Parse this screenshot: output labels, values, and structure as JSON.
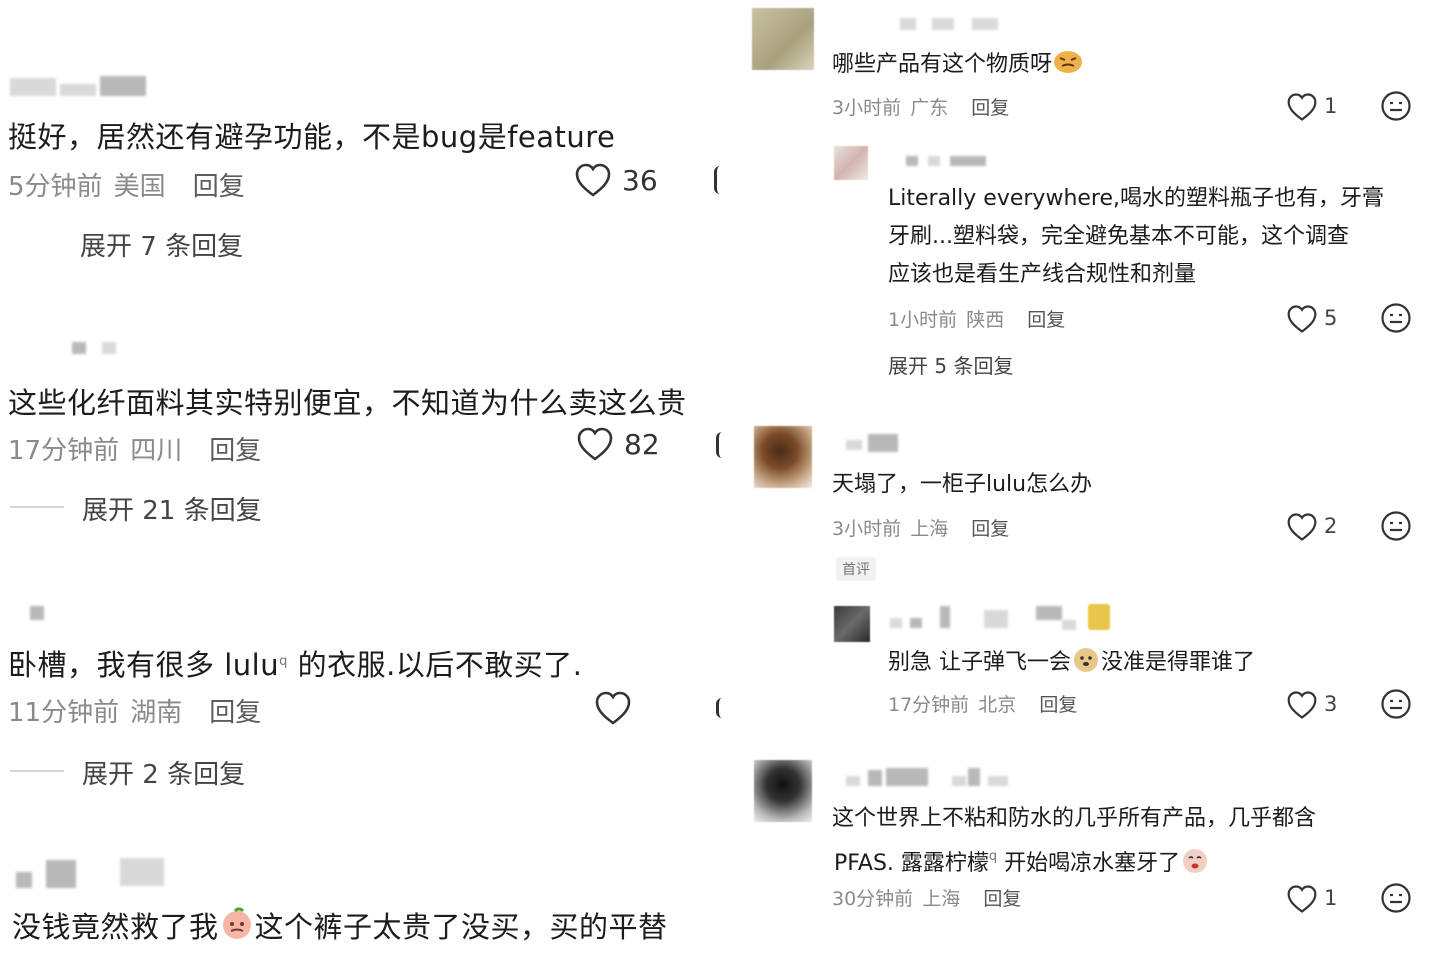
{
  "left": {
    "comments": [
      {
        "text": "挺好，居然还有避孕功能，不是bug是feature",
        "time": "5分钟前",
        "region": "美国",
        "reply": "回复",
        "likes": "36",
        "expand": "展开 7 条回复"
      },
      {
        "text": "这些化纤面料其实特别便宜，不知道为什么卖这么贵",
        "time": "17分钟前",
        "region": "四川",
        "reply": "回复",
        "likes": "82",
        "expand": "展开 21 条回复"
      },
      {
        "text_a": "卧槽，我有很多 lulu",
        "text_b": " 的衣服.以后不敢买了.",
        "time": "11分钟前",
        "region": "湖南",
        "reply": "回复",
        "likes": "",
        "expand": "展开 2 条回复"
      },
      {
        "text_a": "没钱竟然救了我",
        "text_b": "这个裤子太贵了没买，买的平替"
      }
    ]
  },
  "right": {
    "comments": [
      {
        "text": "哪些产品有这个物质呀",
        "time": "3小时前",
        "region": "广东",
        "reply": "回复",
        "likes": "1"
      },
      {
        "lines": [
          "Literally everywhere,喝水的塑料瓶子也有，牙膏",
          "牙刷...塑料袋，完全避免基本不可能，这个调查",
          "应该也是看生产线合规性和剂量"
        ],
        "time": "1小时前",
        "region": "陕西",
        "reply": "回复",
        "likes": "5",
        "expand": "展开 5 条回复"
      },
      {
        "text": "天塌了，一柜子lulu怎么办",
        "time": "3小时前",
        "region": "上海",
        "reply": "回复",
        "likes": "2",
        "badge": "首评"
      },
      {
        "text_a": "别急 让子弹飞一会",
        "text_b": "没准是得罪谁了",
        "time": "17分钟前",
        "region": "北京",
        "reply": "回复",
        "likes": "3"
      },
      {
        "line1": "这个世界上不粘和防水的几乎所有产品，几乎都含",
        "line2_a": "PFAS. 露露柠檬",
        "line2_b": " 开始喝凉水塞牙了",
        "time": "30分钟前",
        "region": "上海",
        "reply": "回复",
        "likes": "1"
      }
    ]
  },
  "icons": {
    "like": "heart-outline-icon",
    "more": "smile-face-icon",
    "search": "search-icon"
  }
}
